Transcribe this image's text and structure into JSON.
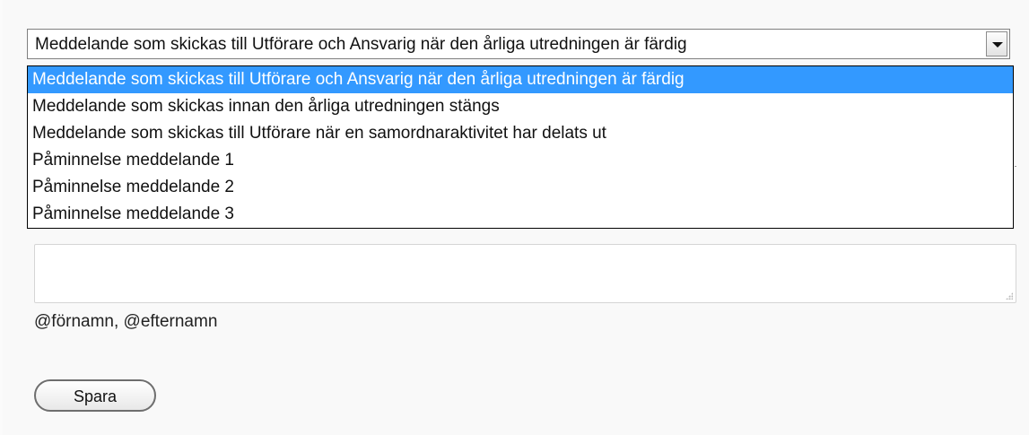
{
  "message_select": {
    "selected_value": "Meddelande som skickas till Utförare och Ansvarig när den årliga utredningen är färdig",
    "options": [
      "Meddelande som skickas till Utförare och Ansvarig när den årliga utredningen är färdig",
      "Meddelande som skickas innan den årliga utredningen stängs",
      "Meddelande som skickas till Utförare när en samordnaraktivitet har delats ut",
      "Påminnelse meddelande 1",
      "Påminnelse meddelande 2",
      "Påminnelse meddelande 3"
    ],
    "highlighted_index": 0
  },
  "message_body": {
    "value": ""
  },
  "variables_hint": "@förnamn, @efternamn",
  "save_button_label": "Spara",
  "colors": {
    "highlight": "#3399ff",
    "background": "#f9f9f9"
  }
}
